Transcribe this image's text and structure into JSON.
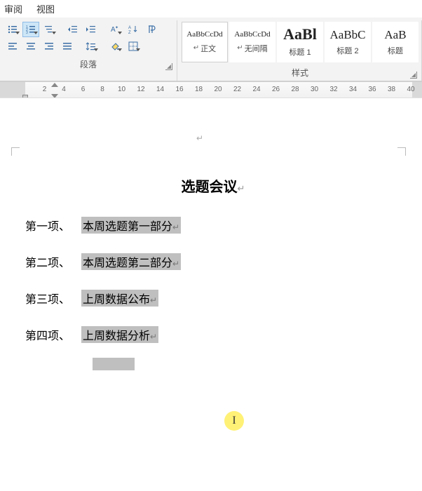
{
  "menu": {
    "review": "审阅",
    "view": "视图"
  },
  "paragraph": {
    "label": "段落",
    "buttons": {
      "bullets": "bullets",
      "numbering": "numbering",
      "multilevel": "multilevel",
      "dec_indent": "decrease-indent",
      "inc_indent": "increase-indent",
      "chinese_layout": "chinese-layout",
      "sort": "sort",
      "show_marks": "show-marks",
      "align_left": "align-left",
      "align_center": "align-center",
      "align_right": "align-right",
      "align_justify": "align-justify",
      "line_spacing": "line-spacing",
      "shading": "shading",
      "borders": "borders"
    }
  },
  "styles": {
    "label": "样式",
    "items": [
      {
        "preview": "AaBbCcDd",
        "preview_size": "11px",
        "name": "正文",
        "para_mark": "↵"
      },
      {
        "preview": "AaBbCcDd",
        "preview_size": "11px",
        "name": "无间隔",
        "para_mark": "↵"
      },
      {
        "preview": "AaBl",
        "preview_size": "22px",
        "name": "标题 1",
        "para_mark": "",
        "bold": true
      },
      {
        "preview": "AaBbC",
        "preview_size": "17px",
        "name": "标题 2",
        "para_mark": ""
      },
      {
        "preview": "AaB",
        "preview_size": "17px",
        "name": "标题",
        "para_mark": ""
      }
    ]
  },
  "ruler": {
    "ticks": [
      "2",
      "4",
      "6",
      "8",
      "10",
      "12",
      "14",
      "16",
      "18",
      "20",
      "22",
      "24",
      "26",
      "28",
      "30",
      "32",
      "34",
      "36",
      "38",
      "40"
    ]
  },
  "document": {
    "title": "选题会议",
    "items": [
      {
        "label": "第一项、",
        "text": "本周选题第一部分"
      },
      {
        "label": "第二项、",
        "text": "本周选题第二部分"
      },
      {
        "label": "第三项、",
        "text": "上周数据公布"
      },
      {
        "label": "第四项、",
        "text": "上周数据分析"
      }
    ],
    "para_end_glyph": "↵"
  },
  "cursor_glyph": "I"
}
